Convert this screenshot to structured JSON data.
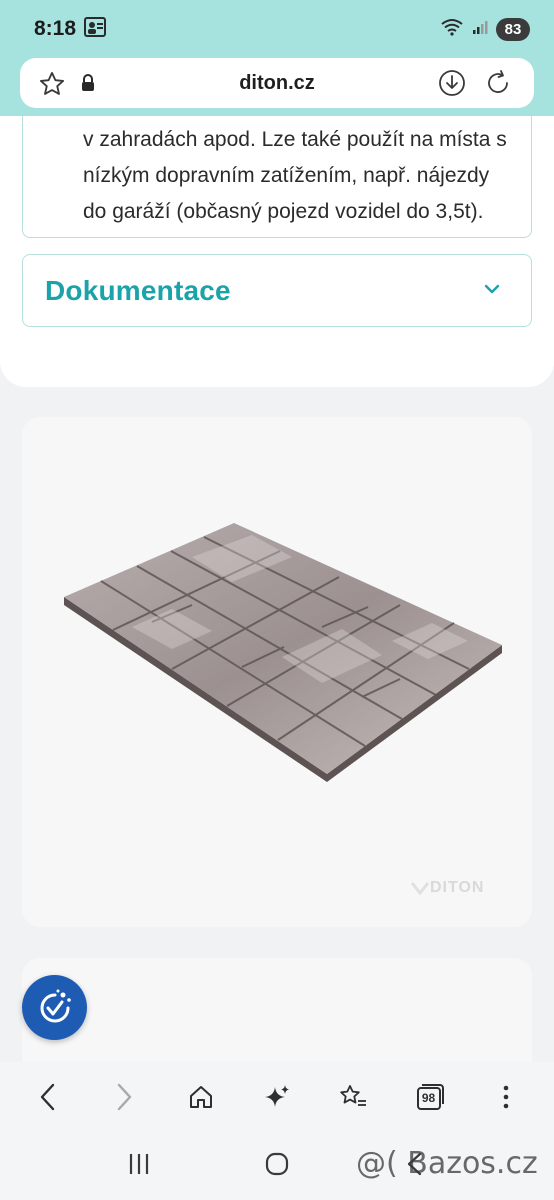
{
  "status_bar": {
    "time": "8:18",
    "battery": "83"
  },
  "browser": {
    "url": "diton.cz"
  },
  "product": {
    "description": "v zahradách apod. Lze také použít na místa s nízkým dopravním zatížením, např. nájezdy do garáží (občasný pojezd vozidel do 3,5t).",
    "documentation_title": "Dokumentace",
    "image_watermark": "DITON"
  },
  "bottom_nav": {
    "tabs_count": "98"
  },
  "watermark": {
    "text": "@( Bazos.cz"
  },
  "colors": {
    "status_bg": "#a6e3df",
    "accent": "#1aa3a8",
    "fab": "#1e5bb3"
  }
}
